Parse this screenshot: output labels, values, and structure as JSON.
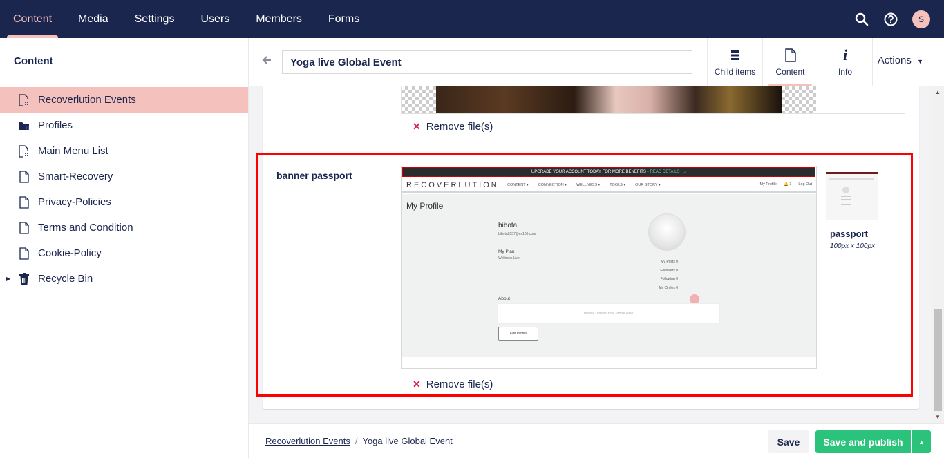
{
  "topnav": {
    "tabs": [
      {
        "label": "Content",
        "active": true
      },
      {
        "label": "Media"
      },
      {
        "label": "Settings"
      },
      {
        "label": "Users"
      },
      {
        "label": "Members"
      },
      {
        "label": "Forms"
      }
    ],
    "icons": [
      "search-icon",
      "help-icon"
    ],
    "avatar_initial": "S"
  },
  "sidebar": {
    "title": "Content",
    "items": [
      {
        "label": "Recoverlution Events",
        "icon": "document-list-icon",
        "active": true
      },
      {
        "label": "Profiles",
        "icon": "folder-user-icon"
      },
      {
        "label": "Main Menu List",
        "icon": "document-list-icon"
      },
      {
        "label": "Smart-Recovery",
        "icon": "document-icon"
      },
      {
        "label": "Privacy-Policies",
        "icon": "document-icon"
      },
      {
        "label": "Terms and Condition",
        "icon": "document-icon"
      },
      {
        "label": "Cookie-Policy",
        "icon": "document-icon"
      },
      {
        "label": "Recycle Bin",
        "icon": "trash-icon",
        "expandable": true
      }
    ]
  },
  "header": {
    "node_name": "Yoga live Global Event",
    "app_tabs": [
      {
        "label": "Child items",
        "icon": "list-icon"
      },
      {
        "label": "Content",
        "icon": "document-icon",
        "active": true
      },
      {
        "label": "Info",
        "icon": "info-icon"
      }
    ],
    "actions_label": "Actions"
  },
  "editor": {
    "remove_label": "Remove file(s)",
    "banner_property_label": "banner passport",
    "thumbnail": {
      "name": "passport",
      "size": "100px x 100px"
    },
    "embedded_screenshot": {
      "banner_text": "UPGRADE YOUR ACCOUNT TODAY FOR MORE BENEFITS -",
      "banner_link": "READ DETAILS",
      "logo": "RECOVERLUTION",
      "menu": [
        "CONTENT ▾",
        "CONNECTION ▾",
        "WELLNESS ▾",
        "TOOLS ▾",
        "OUR STORY ▾"
      ],
      "right_menu": [
        "My Profile",
        "1",
        "Log Out"
      ],
      "page_title": "My Profile",
      "username": "bibota",
      "email": "bibota2637@mi166.com",
      "plan_label": "My Plan",
      "plan_value": "Wellness Live",
      "stats": [
        "My Posts 0",
        "Followers 0",
        "Following 0",
        "My Circles 0"
      ],
      "about_label": "About",
      "about_placeholder": "Please Update Your Profile Now.",
      "edit_button": "Edit Profile"
    }
  },
  "footer": {
    "breadcrumb": [
      "Recoverlution Events",
      "Yoga live Global Event"
    ],
    "save_label": "Save",
    "publish_label": "Save and publish"
  },
  "colors": {
    "nav_bg": "#1b264f",
    "active_accent": "#f5c1bc",
    "publish_green": "#2bc37c",
    "highlight_red": "#ff0000",
    "remove_red": "#d42054"
  }
}
